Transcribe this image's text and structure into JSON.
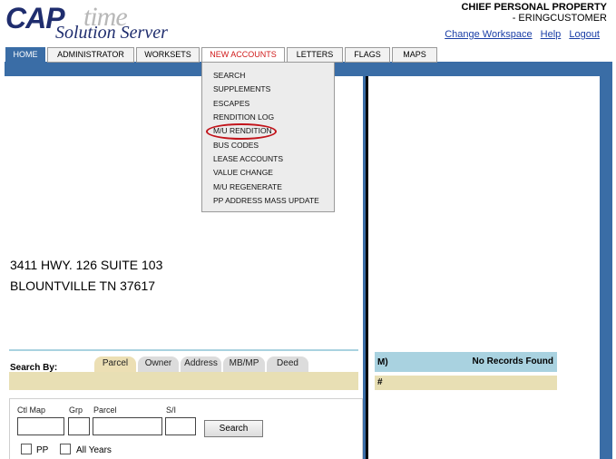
{
  "header": {
    "logo_main": "CAP",
    "logo_script": "time",
    "logo_sub": "Solution Server",
    "title": "CHIEF  PERSONAL PROPERTY",
    "user": "- ERINGCUSTOMER",
    "links": [
      "Change Workspace",
      "Help",
      "Logout"
    ]
  },
  "nav": {
    "tabs": [
      "HOME",
      "ADMINISTRATOR",
      "WORKSETS",
      "NEW ACCOUNTS",
      "LETTERS",
      "FLAGS",
      "MAPS"
    ],
    "active_tab": "NEW ACCOUNTS"
  },
  "dropdown": {
    "items": [
      "SEARCH",
      "SUPPLEMENTS",
      "ESCAPES",
      "RENDITION LOG",
      "M/U RENDITION",
      "BUS CODES",
      "LEASE ACCOUNTS",
      "VALUE CHANGE",
      "M/U REGENERATE",
      "PP ADDRESS MASS UPDATE"
    ],
    "highlighted": "M/U RENDITION"
  },
  "address": {
    "line1": "3411 HWY. 126 SUITE 103",
    "line2": "BLOUNTVILLE TN 37617"
  },
  "search": {
    "search_by_label": "Search By:",
    "tabs": [
      "Parcel",
      "Owner",
      "Address",
      "MB/MP",
      "Deed"
    ],
    "selected_tab": "Parcel",
    "fields": {
      "ctl_map": "Ctl Map",
      "grp": "Grp",
      "parcel": "Parcel",
      "si": "S/I"
    },
    "values": {
      "ctl_map": "",
      "grp": "",
      "parcel": "",
      "si": ""
    },
    "button": "Search",
    "checkboxes": [
      "PP",
      "All Years"
    ]
  },
  "grid": {
    "col_m": "M)",
    "no_records": "No Records Found",
    "row_hash": "#"
  },
  "colors": {
    "nav_blue": "#3a6da6",
    "accent_red": "#d01a1a",
    "band_tan": "#e8dfb4",
    "band_blue": "#a9d2e0"
  }
}
